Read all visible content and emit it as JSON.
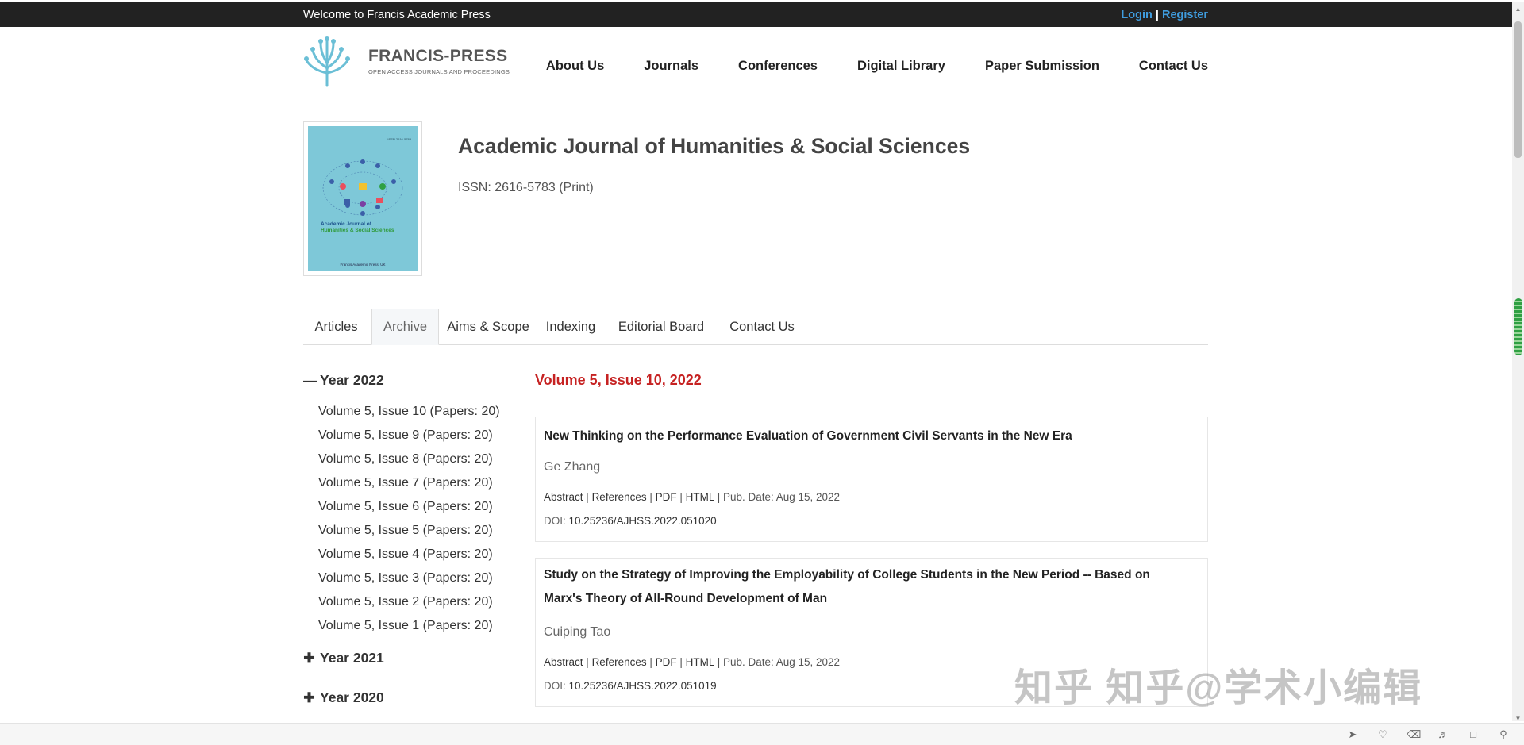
{
  "topbar": {
    "welcome": "Welcome to Francis Academic Press",
    "login": "Login",
    "separator": "|",
    "register": "Register"
  },
  "header": {
    "logo_title": "FRANCIS-PRESS",
    "logo_subtitle": "OPEN ACCESS JOURNALS AND PROCEEDINGS",
    "nav": [
      "About Us",
      "Journals",
      "Conferences",
      "Digital Library",
      "Paper Submission",
      "Contact Us"
    ]
  },
  "journal": {
    "title": "Academic Journal of Humanities & Social Sciences",
    "issn": "ISSN: 2616-5783 (Print)",
    "cover": {
      "title_line1": "Academic Journal of",
      "title_line2": "Humanities & Social Sciences",
      "publisher": "Francis Academic Press, UK",
      "top_label": "ISSN 2616-5783"
    }
  },
  "tabs": [
    "Articles",
    "Archive",
    "Aims & Scope",
    "Indexing",
    "Editorial Board",
    "Contact Us"
  ],
  "active_tab": "Archive",
  "sidebar": {
    "years": [
      {
        "label": "Year 2022",
        "expanded": true,
        "icon": "minus-icon"
      },
      {
        "label": "Year 2021",
        "expanded": false,
        "icon": "plus-icon"
      },
      {
        "label": "Year 2020",
        "expanded": false,
        "icon": "plus-icon"
      }
    ],
    "volumes": [
      "Volume 5, Issue 10 (Papers: 20)",
      "Volume 5, Issue 9 (Papers: 20)",
      "Volume 5, Issue 8 (Papers: 20)",
      "Volume 5, Issue 7 (Papers: 20)",
      "Volume 5, Issue 6 (Papers: 20)",
      "Volume 5, Issue 5 (Papers: 20)",
      "Volume 5, Issue 4 (Papers: 20)",
      "Volume 5, Issue 3 (Papers: 20)",
      "Volume 5, Issue 2 (Papers: 20)",
      "Volume 5, Issue 1 (Papers: 20)"
    ]
  },
  "issue": {
    "title": "Volume 5, Issue 10, 2022",
    "papers": [
      {
        "title_lines": [
          "New Thinking on the Performance Evaluation of Government Civil Servants in the New Era"
        ],
        "author": "Ge Zhang",
        "links": {
          "abstract": "Abstract",
          "references": "References",
          "pdf": "PDF",
          "html": "HTML",
          "sep": "|",
          "date": "Pub. Date: Aug 15, 2022"
        },
        "doi_label": "DOI:",
        "doi": "10.25236/AJHSS.2022.051020"
      },
      {
        "title_lines": [
          "Study on the Strategy of Improving the Employability of College Students in the New Period -- Based on",
          "Marx's Theory of All-Round Development of Man"
        ],
        "author": "Cuiping Tao",
        "links": {
          "abstract": "Abstract",
          "references": "References",
          "pdf": "PDF",
          "html": "HTML",
          "sep": "|",
          "date": "Pub. Date: Aug 15, 2022"
        },
        "doi_label": "DOI:",
        "doi": "10.25236/AJHSS.2022.051019"
      }
    ]
  },
  "watermark": "知乎 知乎@学术小编辑",
  "colors": {
    "topbar_bg": "#222222",
    "link_blue": "#3f9cde",
    "issue_red": "#c62222",
    "cover_teal": "#7ec8d8"
  }
}
